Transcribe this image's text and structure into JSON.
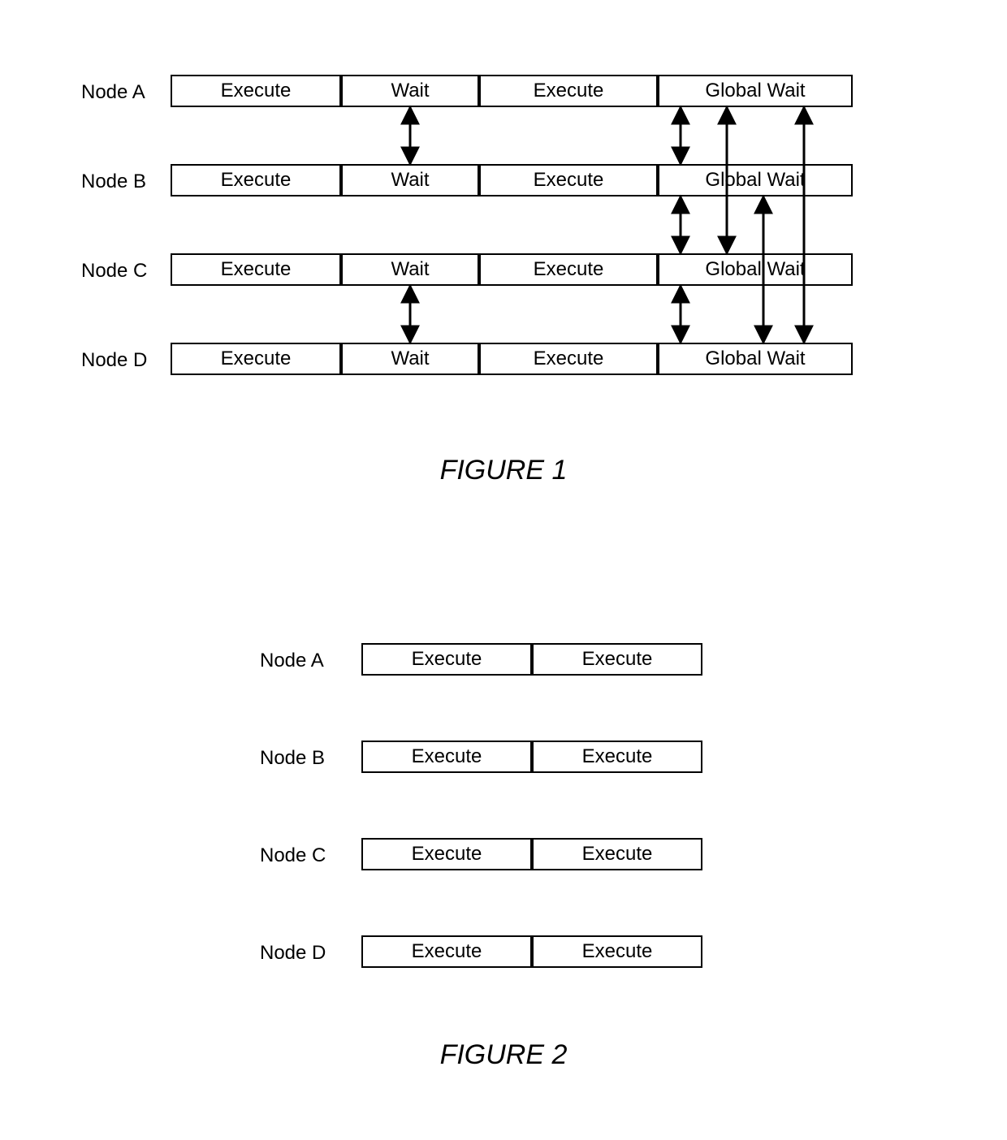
{
  "figure1": {
    "caption": "FIGURE 1",
    "nodes": [
      {
        "label": "Node A",
        "cells": [
          "Execute",
          "Wait",
          "Execute",
          "Global Wait"
        ]
      },
      {
        "label": "Node B",
        "cells": [
          "Execute",
          "Wait",
          "Execute",
          "Global Wait"
        ]
      },
      {
        "label": "Node C",
        "cells": [
          "Execute",
          "Wait",
          "Execute",
          "Global Wait"
        ]
      },
      {
        "label": "Node D",
        "cells": [
          "Execute",
          "Wait",
          "Execute",
          "Global Wait"
        ]
      }
    ]
  },
  "figure2": {
    "caption": "FIGURE 2",
    "nodes": [
      {
        "label": "Node A",
        "cells": [
          "Execute",
          "Execute"
        ]
      },
      {
        "label": "Node B",
        "cells": [
          "Execute",
          "Execute"
        ]
      },
      {
        "label": "Node C",
        "cells": [
          "Execute",
          "Execute"
        ]
      },
      {
        "label": "Node D",
        "cells": [
          "Execute",
          "Execute"
        ]
      }
    ]
  }
}
